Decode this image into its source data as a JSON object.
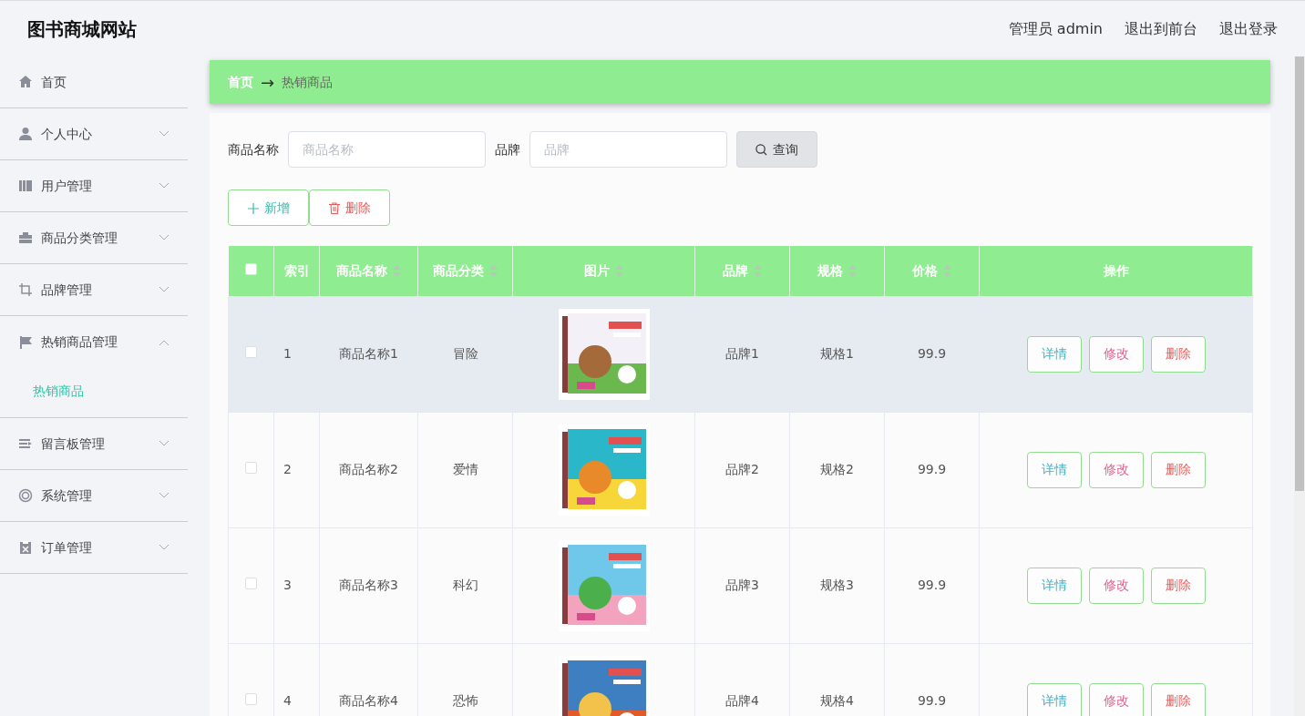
{
  "header": {
    "title": "图书商城网站",
    "links": [
      "管理员 admin",
      "退出到前台",
      "退出登录"
    ]
  },
  "sidebar": {
    "items": [
      {
        "label": "首页"
      },
      {
        "label": "个人中心",
        "expanded": false
      },
      {
        "label": "用户管理",
        "expanded": false
      },
      {
        "label": "商品分类管理",
        "expanded": false
      },
      {
        "label": "品牌管理",
        "expanded": false
      },
      {
        "label": "热销商品管理",
        "expanded": true,
        "children": [
          {
            "label": "热销商品",
            "selected": true
          }
        ]
      },
      {
        "label": "留言板管理",
        "expanded": false
      },
      {
        "label": "系统管理",
        "expanded": false
      },
      {
        "label": "订单管理",
        "expanded": false
      }
    ]
  },
  "breadcrumb": {
    "items": [
      "首页",
      "热销商品"
    ],
    "separator": "→"
  },
  "search": {
    "fields": [
      {
        "label": "商品名称",
        "placeholder": "商品名称"
      },
      {
        "label": "品牌",
        "placeholder": "品牌"
      }
    ],
    "button": "查询"
  },
  "actions": [
    {
      "label": "新增",
      "kind": "add"
    },
    {
      "label": "删除",
      "kind": "delete"
    }
  ],
  "table": {
    "select_all_checked": false,
    "columns": [
      {
        "label": "索引",
        "sortable": false
      },
      {
        "label": "商品名称",
        "sortable": true
      },
      {
        "label": "商品分类",
        "sortable": true
      },
      {
        "label": "图片",
        "sortable": true
      },
      {
        "label": "品牌",
        "sortable": true
      },
      {
        "label": "规格",
        "sortable": true
      },
      {
        "label": "价格",
        "sortable": true
      },
      {
        "label": "操作",
        "sortable": false
      }
    ],
    "rows": [
      {
        "index": "1",
        "name": "商品名称1",
        "category": "冒险",
        "picture": {
          "kind": "picture"
        },
        "brand": "品牌1",
        "spec": "规格1",
        "price": "99.9",
        "highlighted": true,
        "checked": false,
        "buttons": [
          {
            "label": "详情",
            "kind": "detail"
          },
          {
            "label": "修改",
            "kind": "edit"
          },
          {
            "label": "删除",
            "kind": "delete"
          }
        ]
      },
      {
        "index": "2",
        "name": "商品名称2",
        "category": "爱情",
        "picture": {
          "kind": "picture"
        },
        "brand": "品牌2",
        "spec": "规格2",
        "price": "99.9",
        "highlighted": false,
        "checked": false,
        "buttons": [
          {
            "label": "详情",
            "kind": "detail"
          },
          {
            "label": "修改",
            "kind": "edit"
          },
          {
            "label": "删除",
            "kind": "delete"
          }
        ]
      },
      {
        "index": "3",
        "name": "商品名称3",
        "category": "科幻",
        "picture": {
          "kind": "picture"
        },
        "brand": "品牌3",
        "spec": "规格3",
        "price": "99.9",
        "highlighted": false,
        "checked": false,
        "buttons": [
          {
            "label": "详情",
            "kind": "detail"
          },
          {
            "label": "修改",
            "kind": "edit"
          },
          {
            "label": "删除",
            "kind": "delete"
          }
        ]
      },
      {
        "index": "4",
        "name": "商品名称4",
        "category": "恐怖",
        "picture": {
          "kind": "picture"
        },
        "brand": "品牌4",
        "spec": "规格4",
        "price": "99.9",
        "highlighted": false,
        "checked": false,
        "buttons": [
          {
            "label": "详情",
            "kind": "detail"
          },
          {
            "label": "修改",
            "kind": "edit"
          },
          {
            "label": "删除",
            "kind": "delete"
          }
        ]
      }
    ]
  }
}
